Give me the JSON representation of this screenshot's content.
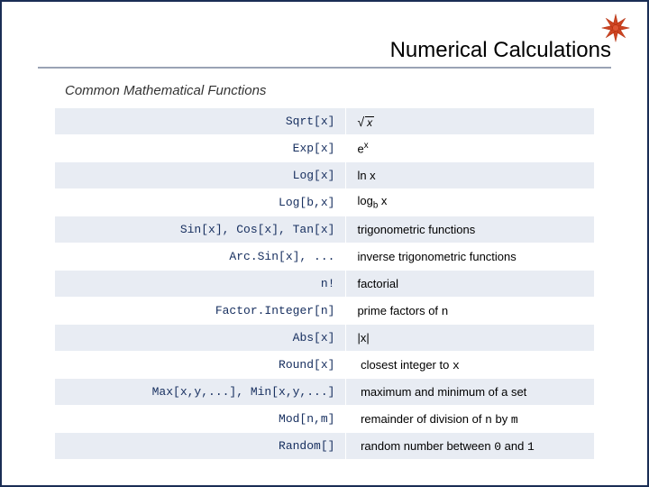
{
  "title": "Numerical Calculations",
  "subtitle": "Common Mathematical Functions",
  "logo_name": "mathematica-spikey-icon",
  "rows": [
    {
      "func": "Sqrt[x]",
      "desc_html": "<span class='sqrt-sym'>√</span><span class='sqrt-box'>x</span>"
    },
    {
      "func": "Exp[x]",
      "desc_html": "e<span class='sup'>x</span>"
    },
    {
      "func": "Log[x]",
      "desc_html": "ln x"
    },
    {
      "func": "Log[b,x]",
      "desc_html": "log<span class='sub'>b</span> x"
    },
    {
      "func": "Sin[x], Cos[x], Tan[x]",
      "desc_html": "trigonometric functions"
    },
    {
      "func": "Arc.Sin[x], ...",
      "desc_html": "inverse trigonometric functions"
    },
    {
      "func": "n!",
      "desc_html": "factorial"
    },
    {
      "func": "Factor.Integer[n]",
      "desc_html": "prime factors of <span class='mono'>n</span>"
    },
    {
      "func": "Abs[x]",
      "desc_html": "|x|"
    },
    {
      "func": "Round[x]",
      "desc_html": "&nbsp;closest integer to <span class='mono'>x</span>"
    },
    {
      "func": "Max[x,y,...], Min[x,y,...]",
      "desc_html": "&nbsp;maximum and minimum of a set"
    },
    {
      "func": "Mod[n,m]",
      "desc_html": "&nbsp;remainder of division of <span class='mono'>n</span> by <span class='mono'>m</span>"
    },
    {
      "func": "Random[]",
      "desc_html": "&nbsp;random number between <span class='mono'>0</span> and <span class='mono'>1</span>"
    }
  ]
}
